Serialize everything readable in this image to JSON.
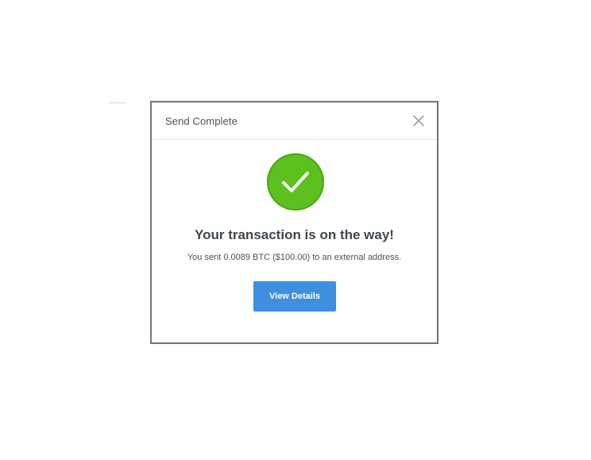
{
  "modal": {
    "title": "Send Complete",
    "close_icon": "close-icon",
    "status_icon": "checkmark-icon",
    "headline": "Your transaction is on the way!",
    "message": "You sent 0.0089 BTC ($100.00) to an external address.",
    "view_details_label": "View Details"
  },
  "colors": {
    "success_green": "#5cc01e",
    "button_blue": "#3d8fe0",
    "modal_border": "#6f767d",
    "text_dark": "#3f464d"
  }
}
